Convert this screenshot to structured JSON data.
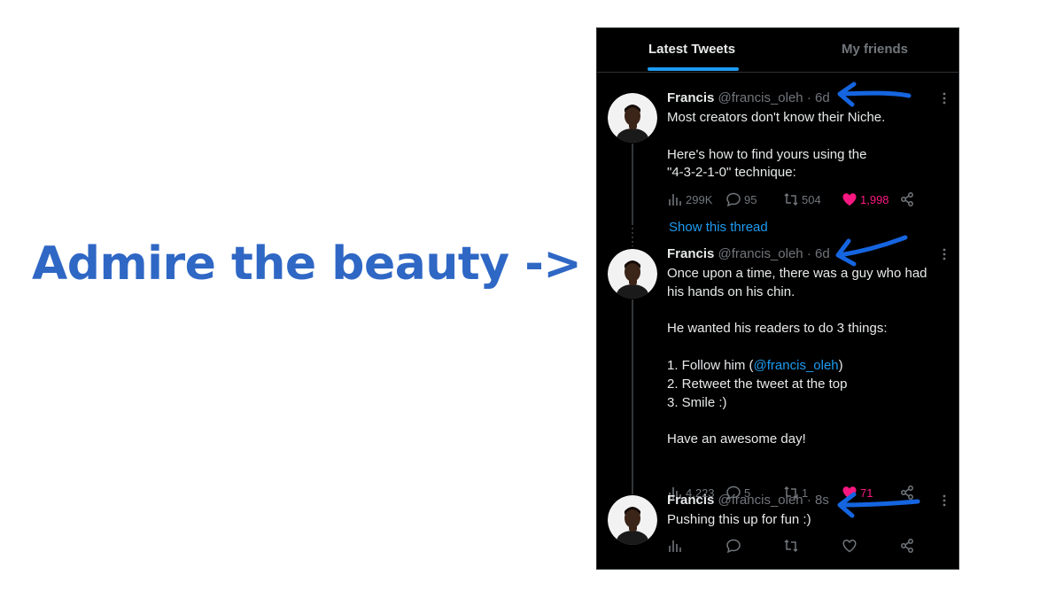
{
  "headline": "Admire the beauty ->",
  "tabs": [
    {
      "label": "Latest Tweets",
      "active": true
    },
    {
      "label": "My friends",
      "active": false
    }
  ],
  "accent_color": "#1d9bf0",
  "like_color": "#f91880",
  "headline_color": "#2f67c5",
  "tweets": [
    {
      "name": "Francis",
      "handle": "@francis_oleh",
      "separator": "·",
      "time": "6d",
      "more_icon": "more-icon",
      "lines": [
        "Most creators don't know their Niche.",
        "",
        "Here's how to find yours using the",
        "\"4-3-2-1-0\" technique:"
      ],
      "stats": {
        "views": "299K",
        "replies": "95",
        "retweets": "504",
        "likes": "1,998",
        "liked": true
      }
    },
    {
      "name": "Francis",
      "handle": "@francis_oleh",
      "separator": "·",
      "time": "6d",
      "lines_before": [
        "Once upon a time, there was a guy who had",
        "his hands on his chin.",
        "",
        "He wanted his readers to do 3 things:",
        ""
      ],
      "follow_prefix": "1. Follow him (",
      "follow_mention": "@francis_oleh",
      "follow_suffix": ")",
      "lines_after": [
        "2. Retweet the tweet at the top",
        "3. Smile :)",
        "",
        "Have an awesome day!"
      ],
      "stats": {
        "views": "4,223",
        "replies": "5",
        "retweets": "1",
        "likes": "71",
        "liked": true
      }
    },
    {
      "name": "Francis",
      "handle": "@francis_oleh",
      "separator": "·",
      "time": "8s",
      "lines": [
        "Pushing this up for fun :)"
      ],
      "stats": {
        "views": "",
        "replies": "",
        "retweets": "",
        "likes": "",
        "liked": false
      }
    }
  ],
  "show_thread": "Show this thread",
  "icons": [
    "views-icon",
    "reply-icon",
    "retweet-icon",
    "heart-icon",
    "share-icon",
    "blue-arrow-annotation"
  ]
}
